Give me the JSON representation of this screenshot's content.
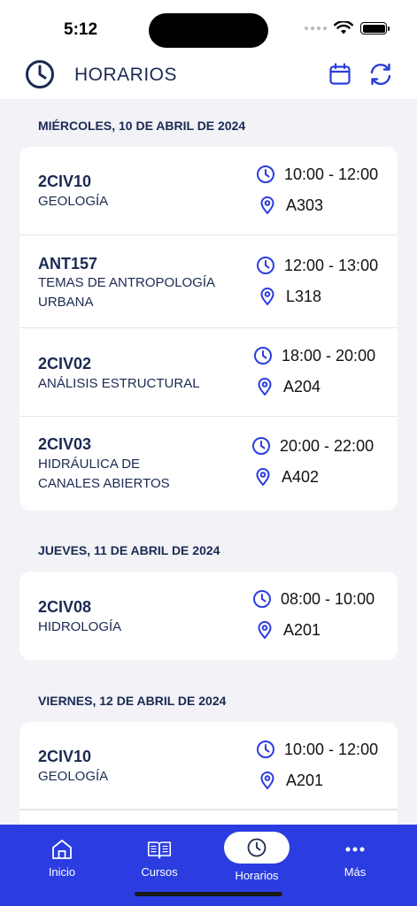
{
  "status": {
    "time": "5:12"
  },
  "header": {
    "title": "HORARIOS"
  },
  "days": [
    {
      "date": "MIÉRCOLES, 10 DE ABRIL DE 2024",
      "courses": [
        {
          "code": "2CIV10",
          "name": "GEOLOGÍA",
          "time": "10:00 - 12:00",
          "room": "A303"
        },
        {
          "code": "ANT157",
          "name": "TEMAS DE ANTROPOLOGÍA URBANA",
          "time": "12:00 - 13:00",
          "room": "L318"
        },
        {
          "code": "2CIV02",
          "name": "ANÁLISIS ESTRUCTURAL",
          "time": "18:00 - 20:00",
          "room": "A204"
        },
        {
          "code": "2CIV03",
          "name": "HIDRÁULICA DE CANALES ABIERTOS",
          "time": "20:00 - 22:00",
          "room": "A402"
        }
      ]
    },
    {
      "date": "JUEVES, 11 DE ABRIL DE 2024",
      "courses": [
        {
          "code": "2CIV08",
          "name": "HIDROLOGÍA",
          "time": "08:00 - 10:00",
          "room": "A201"
        }
      ]
    },
    {
      "date": "VIERNES, 12 DE ABRIL DE 2024",
      "courses": [
        {
          "code": "2CIV10",
          "name": "GEOLOGÍA",
          "time": "10:00 - 12:00",
          "room": "A201"
        }
      ]
    }
  ],
  "tabs": [
    {
      "label": "Inicio",
      "icon": "home-icon"
    },
    {
      "label": "Cursos",
      "icon": "book-icon"
    },
    {
      "label": "Horarios",
      "icon": "clock-icon"
    },
    {
      "label": "Más",
      "icon": "more-icon"
    }
  ],
  "colors": {
    "accent": "#2b3de0",
    "text": "#1b2a52",
    "background": "#f2f2f7"
  }
}
